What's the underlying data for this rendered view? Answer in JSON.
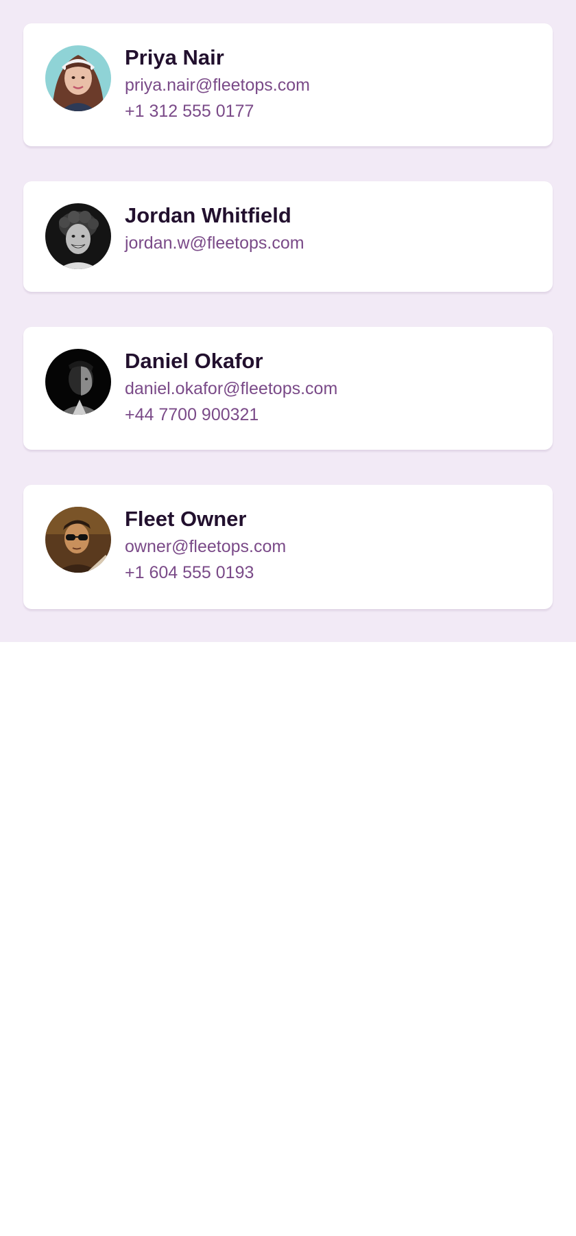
{
  "contacts": [
    {
      "name": "Priya Nair",
      "email": "priya.nair@fleetops.com",
      "phone": "+1 312 555 0177",
      "avatar_icon": "avatar-photo-woman-headband"
    },
    {
      "name": "Jordan Whitfield",
      "email": "jordan.w@fleetops.com",
      "phone": null,
      "avatar_icon": "avatar-photo-man-curly-hair"
    },
    {
      "name": "Daniel Okafor",
      "email": "daniel.okafor@fleetops.com",
      "phone": "+44 7700 900321",
      "avatar_icon": "avatar-photo-man-dark"
    },
    {
      "name": "Fleet Owner",
      "email": "owner@fleetops.com",
      "phone": "+1 604 555 0193",
      "avatar_icon": "avatar-photo-man-sunglasses"
    }
  ],
  "colors": {
    "panel_background": "#f2eaf6",
    "card_background": "#ffffff",
    "name_text": "#22102e",
    "secondary_text": "#7a4a88"
  }
}
